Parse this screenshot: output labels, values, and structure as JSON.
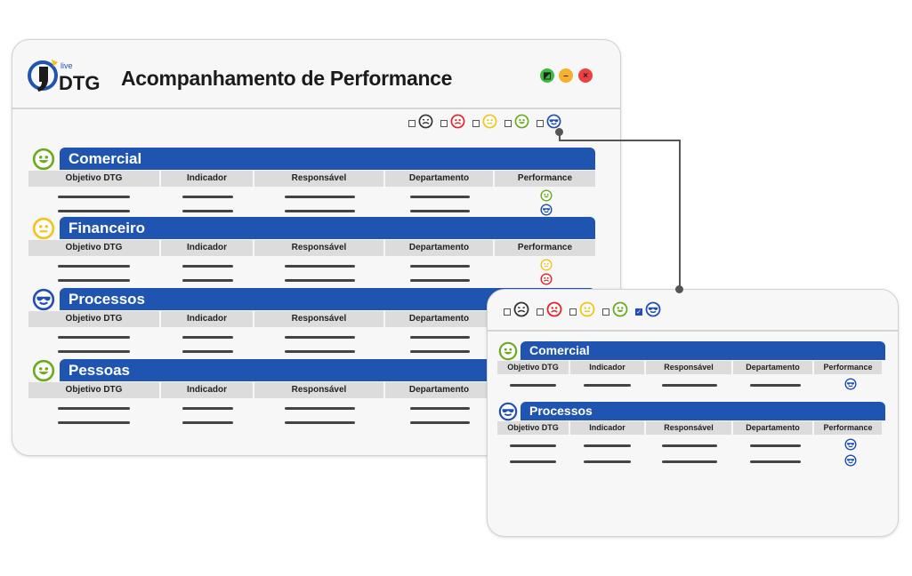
{
  "app": {
    "logo_small": "live",
    "logo_text": "DTG",
    "title": "Acompanhamento de Performance"
  },
  "window_controls": [
    "maximize",
    "minimize",
    "close"
  ],
  "colors": {
    "accent": "#1f55b0",
    "very_bad": "#333333",
    "bad": "#e8202a",
    "neutral": "#f2c31b",
    "good": "#6aab1e",
    "excellent": "#1f4fb5"
  },
  "columns": [
    "Objetivo DTG",
    "Indicador",
    "Responsável",
    "Departamento",
    "Performance"
  ],
  "main": {
    "filters": [
      {
        "face": "very_bad",
        "checked": false
      },
      {
        "face": "bad",
        "checked": false
      },
      {
        "face": "neutral",
        "checked": false
      },
      {
        "face": "good",
        "checked": false
      },
      {
        "face": "excellent",
        "checked": false
      }
    ],
    "sections": [
      {
        "name": "Comercial",
        "face": "good",
        "rows": [
          "good",
          "excellent"
        ]
      },
      {
        "name": "Financeiro",
        "face": "neutral",
        "rows": [
          "neutral",
          "bad"
        ]
      },
      {
        "name": "Processos",
        "face": "excellent",
        "rows": [
          null,
          null
        ]
      },
      {
        "name": "Pessoas",
        "face": "good",
        "rows": [
          null,
          null
        ]
      }
    ]
  },
  "filtered": {
    "filters": [
      {
        "face": "very_bad",
        "checked": false
      },
      {
        "face": "bad",
        "checked": false
      },
      {
        "face": "neutral",
        "checked": false
      },
      {
        "face": "good",
        "checked": false
      },
      {
        "face": "excellent",
        "checked": true
      }
    ],
    "sections": [
      {
        "name": "Comercial",
        "face": "good",
        "rows": [
          "excellent"
        ]
      },
      {
        "name": "Processos",
        "face": "excellent",
        "rows": [
          "excellent",
          "excellent"
        ]
      }
    ]
  }
}
